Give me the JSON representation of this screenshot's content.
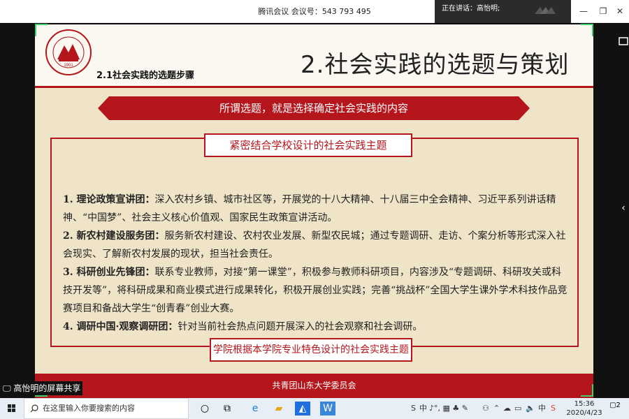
{
  "window": {
    "title": "腾讯会议 会议号：543 793 495",
    "speaking": "正在讲话：高怡明;",
    "minimize": "—",
    "restore": "❐",
    "close": "✕"
  },
  "slide": {
    "subtitle": "2.1社会实践的选题步骤",
    "main_title": "2.社会实践的选题与策划",
    "ribbon": "所谓选题，就是选择确定社会实践的内容",
    "theme": "紧密结合学校设计的社会实践主题",
    "items": [
      {
        "head": "1. 理论政策宣讲团：",
        "body": "深入农村乡镇、城市社区等，开展党的十八大精神、十八届三中全会精神、习近平系列讲话精神、“中国梦”、社会主义核心价值观、国家民生政策宣讲活动。"
      },
      {
        "head": "2. 新农村建设服务团：",
        "body": "服务新农村建设、农村农业发展、新型农民城；通过专题调研、走访、个案分析等形式深入社会现实、了解新农村发展的现状，担当社会责任。"
      },
      {
        "head": "3. 科研创业先锋团：",
        "body": "联系专业教师，对接“第一课堂”，积极参与教师科研项目，内容涉及“专题调研、科研攻关或科技开发等”，将科研成果和商业模式进行成果转化，积极开展创业实践；完善“挑战杯”全国大学生课外学术科技作品竞赛项目和备战大学生“创青春”创业大赛。"
      },
      {
        "head": "4. 调研中国·观察调研团：",
        "body": "针对当前社会热点问题开展深入的社会观察和社会调研。"
      }
    ],
    "footer_box": "学院根据本学院专业特色设计的社会实践主题",
    "footer": "共青团山东大学委员会",
    "logo_text": "SHANDONG UNIVERSITY",
    "logo_year": "1901"
  },
  "share_label": "高怡明的屏幕共享",
  "taskbar": {
    "search_placeholder": "在这里输入你要搜索的内容",
    "tray_ime": "中",
    "tray_lang": "中",
    "time": "15:36",
    "date": "2020/4/23",
    "notif_count": "2"
  },
  "colors": {
    "accent": "#b4161c",
    "slide_bg": "#efe3c8",
    "corner": "#3cd070"
  }
}
